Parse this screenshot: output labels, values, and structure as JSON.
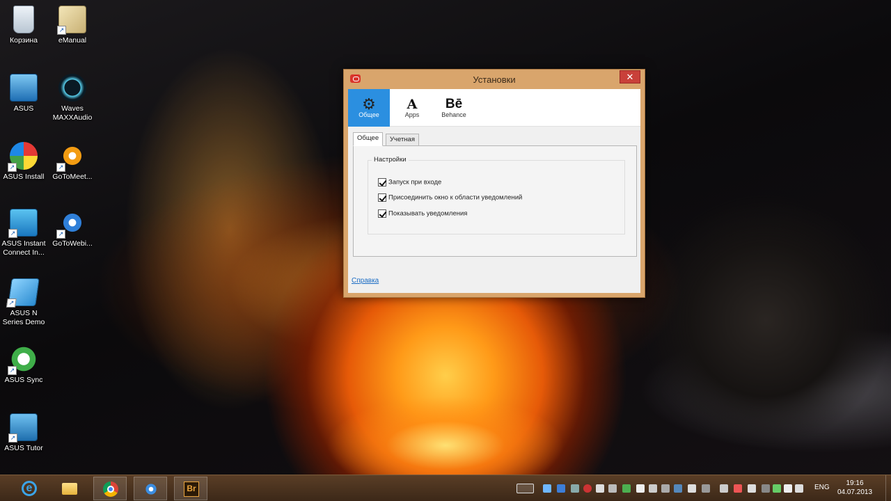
{
  "desktop": {
    "icons": [
      {
        "label": "Корзина",
        "icon": "recycle-bin-icon"
      },
      {
        "label": "eManual",
        "icon": "emanual-icon"
      },
      {
        "label": "ASUS",
        "icon": "asus-folder-icon"
      },
      {
        "label": "Waves MAXXAudio",
        "icon": "waves-icon"
      },
      {
        "label": "ASUS Install",
        "icon": "asus-install-icon"
      },
      {
        "label": "GoToMeet...",
        "icon": "gotomeeting-icon"
      },
      {
        "label": "ASUS Instant Connect In...",
        "icon": "asus-instant-connect-icon"
      },
      {
        "label": "GoToWebi...",
        "icon": "gotowebinar-icon"
      },
      {
        "label": "ASUS N Series Demo",
        "icon": "asus-n-series-icon"
      },
      {
        "label": "ASUS Sync",
        "icon": "asus-sync-icon"
      },
      {
        "label": "ASUS Tutor",
        "icon": "asus-tutor-icon"
      }
    ]
  },
  "dialog": {
    "title": "Установки",
    "close_glyph": "✕",
    "toolbar": [
      {
        "label": "Общее",
        "glyph": "⚙",
        "icon": "gear-icon"
      },
      {
        "label": "Apps",
        "glyph": "A",
        "icon": "adobe-apps-icon"
      },
      {
        "label": "Behance",
        "glyph": "Bē",
        "icon": "behance-icon"
      }
    ],
    "tabs": [
      "Общее",
      "Учетная запись"
    ],
    "group_title": "Настройки",
    "checkboxes": [
      {
        "label": "Запуск при входе",
        "checked": true
      },
      {
        "label": "Присоединить окно к области уведомлений",
        "checked": true
      },
      {
        "label": "Показывать уведомления",
        "checked": true
      }
    ],
    "help_link": "Справка"
  },
  "taskbar": {
    "apps": [
      "internet-explorer-icon",
      "file-explorer-icon",
      "chrome-icon",
      "gotomeeting-taskbar-icon",
      "bridge-icon"
    ],
    "bridge_glyph": "Br",
    "ie_glyph": "e",
    "language": "ENG",
    "time": "19:16",
    "date": "04.07.2013"
  }
}
